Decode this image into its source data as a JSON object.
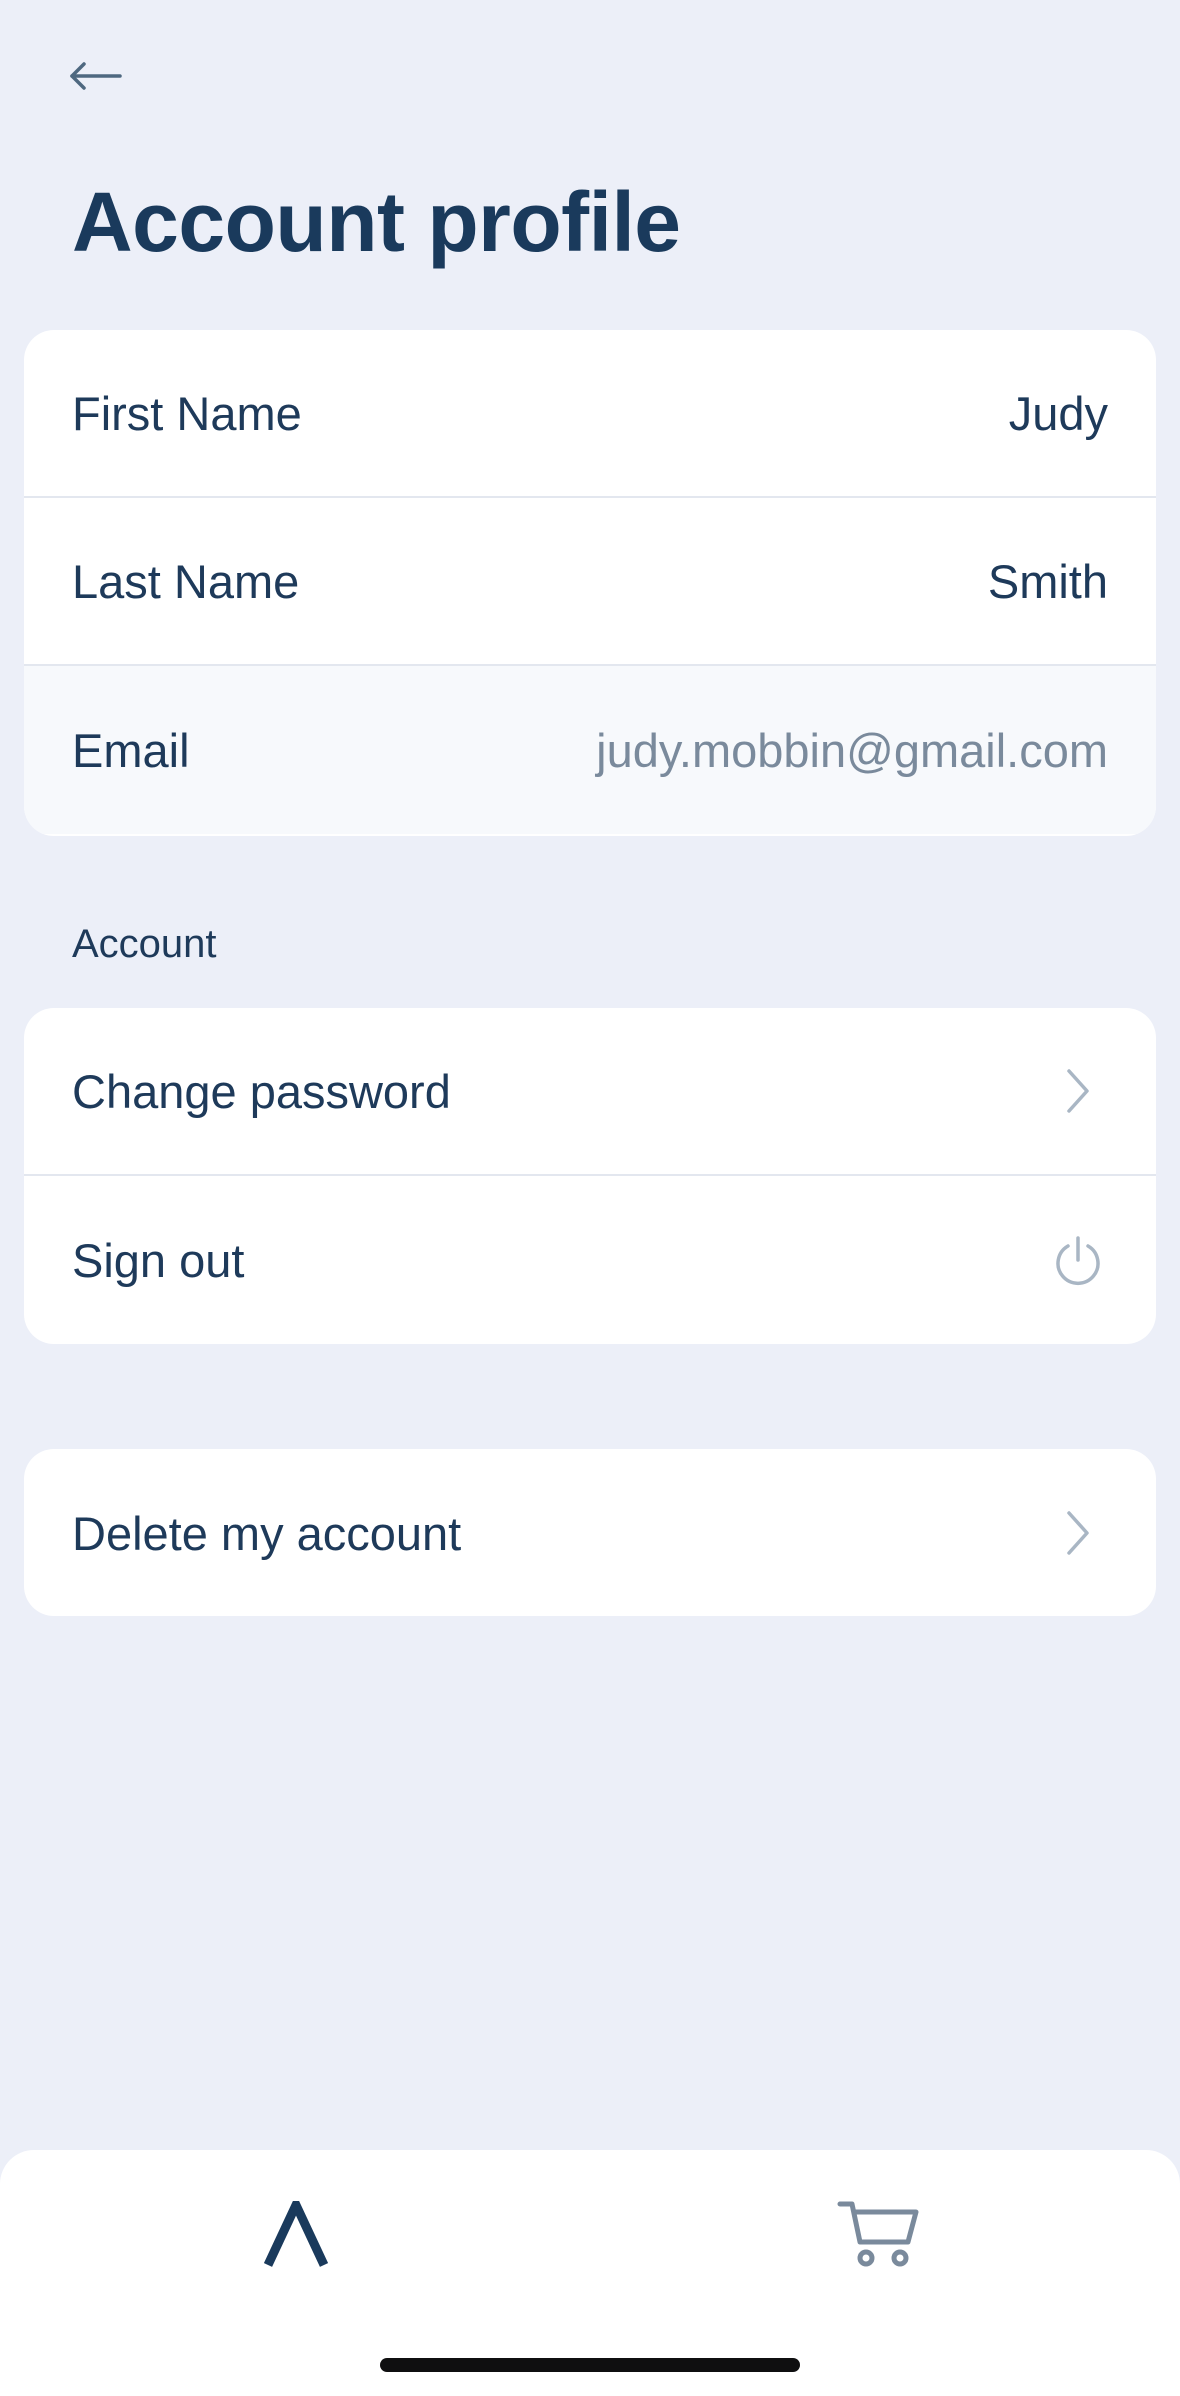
{
  "header": {
    "back_icon": "arrow-left-icon",
    "title": "Account profile"
  },
  "profile": {
    "first_name_label": "First Name",
    "first_name_value": "Judy",
    "last_name_label": "Last Name",
    "last_name_value": "Smith",
    "email_label": "Email",
    "email_value": "judy.mobbin@gmail.com"
  },
  "account_section": {
    "label": "Account",
    "change_password": "Change password",
    "sign_out": "Sign out"
  },
  "danger_section": {
    "delete_account": "Delete my account"
  },
  "tab_bar": {
    "home_icon": "lambda-logo-icon",
    "cart_icon": "cart-icon"
  },
  "colors": {
    "background": "#ECEFF8",
    "primary_text": "#1A3A5C",
    "muted_text": "#7A8A9C",
    "card": "#FFFFFF"
  }
}
